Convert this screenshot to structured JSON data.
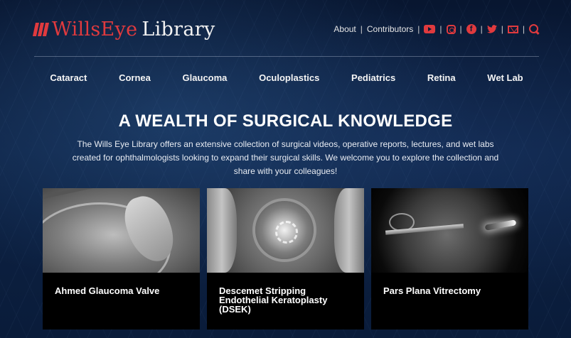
{
  "logo": {
    "red_text": "WillsEye",
    "white_text": "Library"
  },
  "topnav": {
    "about": "About",
    "contributors": "Contributors",
    "separator": "|"
  },
  "social_icons": [
    "youtube-icon",
    "instagram-icon",
    "facebook-icon",
    "twitter-icon",
    "email-icon",
    "search-icon"
  ],
  "categories": [
    "Cataract",
    "Cornea",
    "Glaucoma",
    "Oculoplastics",
    "Pediatrics",
    "Retina",
    "Wet Lab"
  ],
  "hero": {
    "headline": "A WEALTH OF SURGICAL KNOWLEDGE",
    "intro": "The Wills Eye Library offers an extensive collection of surgical videos, operative reports, lectures, and wet labs created for ophthalmologists looking to expand their surgical skills. We welcome you to explore the collection and share with your colleagues!"
  },
  "cards": [
    {
      "title": "Ahmed Glaucoma Valve"
    },
    {
      "title": "Descemet Stripping Endothelial Keratoplasty (DSEK)"
    },
    {
      "title": "Pars Plana Vitrectomy"
    }
  ],
  "colors": {
    "brand_red": "#e03a3e",
    "background_navy": "#0b1a33",
    "card_black": "#000000"
  }
}
